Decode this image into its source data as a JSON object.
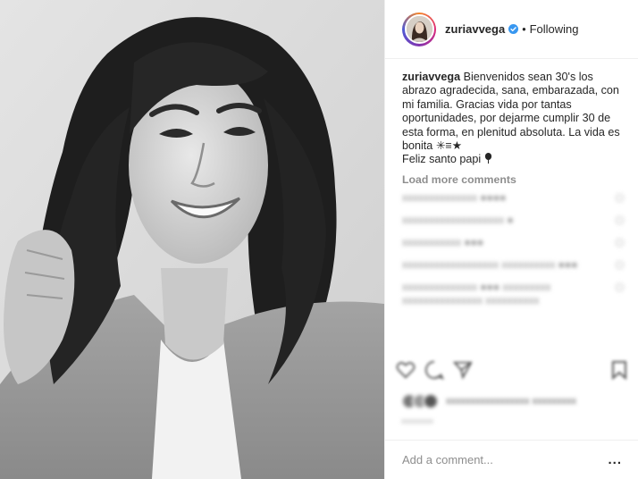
{
  "post": {
    "username": "zuriavvega",
    "follow_status": "Following",
    "separator": "•",
    "caption": {
      "username": "zuriavvega",
      "text": "Bienvenidos sean 30's los abrazo agradecida, sana, embarazada, con mi familia. Gracias vida por tantas oportunidades, por dejarme cumplir 30 de esta forma, en plenitud absoluta. La vida es bonita",
      "emoji_line1": "✳︎≡★",
      "line2": "Feliz santo papi",
      "emoji_line2": "🎈"
    },
    "load_more": "Load more comments",
    "comments": [
      {
        "text": "xxxxxxxxxxxxxx ●●●●"
      },
      {
        "text": "xxxxxxxxxxxxxxxxxxx ●"
      },
      {
        "text": "xxxxxxxxxxx ●●●"
      },
      {
        "text": "xxxxxxxxxxxxxxxxxx xxxxxxxxxx ●●●"
      },
      {
        "text": "xxxxxxxxxxxxxx ●●● xxxxxxxxx xxxxxxxxxxxxxxx xxxxxxxxxx"
      }
    ],
    "likes_text": "xxxxxxxxxxxxxxxxx xxxxxxxxx",
    "timestamp": "xxxxxxxx",
    "add_comment_placeholder": "Add a comment...",
    "more_label": "..."
  },
  "colors": {
    "text": "#262626",
    "muted": "#8e8e8e",
    "verified": "#3897f0",
    "border": "#efefef"
  },
  "icons": [
    "verified-badge-icon",
    "heart-icon",
    "comment-icon",
    "share-icon",
    "bookmark-icon",
    "more-options-icon"
  ]
}
